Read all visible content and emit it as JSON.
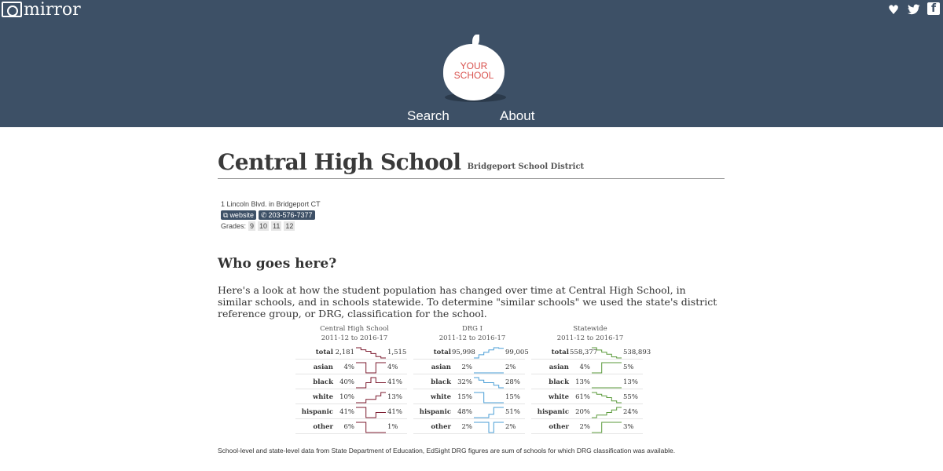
{
  "header": {
    "brand": "mirror",
    "logo_line1": "YOUR",
    "logo_line2": "SCHOOL",
    "nav": [
      "Search",
      "About"
    ],
    "social_icons": [
      "heart-icon",
      "twitter-icon",
      "facebook-icon"
    ]
  },
  "school": {
    "name": "Central High School",
    "district": "Bridgeport School District",
    "address": "1 Lincoln Blvd. in Bridgeport CT",
    "website_label": "website",
    "phone": "203-576-7377",
    "grades_label": "Grades:",
    "grades": [
      "9",
      "10",
      "11",
      "12"
    ]
  },
  "section": {
    "heading": "Who goes here?",
    "paragraph": "Here's a look at how the student population has changed over time at Central High School, in similar schools, and in schools statewide. To determine \"similar schools\" we used the state's district reference group, or DRG, classification for the school."
  },
  "colors": {
    "header_bg": "#3d5066",
    "school": "#7b1a2e",
    "drg": "#4a9ed6",
    "state": "#5a9a3a",
    "logo_text": "#d9534f"
  },
  "chart_data": [
    {
      "type": "line",
      "title": "Central High School",
      "subtitle": "2011-12 to 2016-17",
      "color": "#7b1a2e",
      "rows": [
        {
          "label": "total",
          "start": "2,181",
          "end": "1,515",
          "values": [
            2181,
            2050,
            1950,
            1800,
            1600,
            1515
          ]
        },
        {
          "label": "asian",
          "start": "4%",
          "end": "4%",
          "values": [
            4,
            4,
            1,
            1,
            4,
            4
          ]
        },
        {
          "label": "black",
          "start": "40%",
          "end": "41%",
          "values": [
            40,
            40,
            41,
            42,
            41,
            41
          ]
        },
        {
          "label": "white",
          "start": "10%",
          "end": "13%",
          "values": [
            10,
            10,
            11,
            11,
            12,
            13
          ]
        },
        {
          "label": "hispanic",
          "start": "41%",
          "end": "41%",
          "values": [
            42,
            42,
            40,
            40,
            41,
            41
          ]
        },
        {
          "label": "other",
          "start": "6%",
          "end": "1%",
          "values": [
            6,
            6,
            1,
            1,
            1,
            1
          ]
        }
      ]
    },
    {
      "type": "line",
      "title": "DRG I",
      "subtitle": "2011-12 to 2016-17",
      "color": "#4a9ed6",
      "rows": [
        {
          "label": "total",
          "start": "95,998",
          "end": "99,005",
          "values": [
            95998,
            97000,
            97800,
            98500,
            99200,
            99005
          ]
        },
        {
          "label": "asian",
          "start": "2%",
          "end": "2%",
          "values": [
            2,
            2,
            2,
            2,
            2,
            2
          ]
        },
        {
          "label": "black",
          "start": "32%",
          "end": "28%",
          "values": [
            32,
            31,
            30,
            30,
            29,
            28
          ]
        },
        {
          "label": "white",
          "start": "15%",
          "end": "15%",
          "values": [
            16,
            16,
            15,
            15,
            15,
            15
          ]
        },
        {
          "label": "hispanic",
          "start": "48%",
          "end": "51%",
          "values": [
            48,
            48,
            48,
            49,
            51,
            51
          ]
        },
        {
          "label": "other",
          "start": "2%",
          "end": "2%",
          "values": [
            2,
            2,
            2,
            0,
            2,
            2
          ]
        }
      ]
    },
    {
      "type": "line",
      "title": "Statewide",
      "subtitle": "2011-12 to 2016-17",
      "color": "#5a9a3a",
      "rows": [
        {
          "label": "total",
          "start": "558,377",
          "end": "538,893",
          "values": [
            558377,
            554000,
            550000,
            546000,
            541000,
            538893
          ]
        },
        {
          "label": "asian",
          "start": "4%",
          "end": "5%",
          "values": [
            4,
            4,
            5,
            5,
            5,
            5
          ]
        },
        {
          "label": "black",
          "start": "13%",
          "end": "13%",
          "values": [
            13,
            13,
            13,
            13,
            13,
            13
          ]
        },
        {
          "label": "white",
          "start": "61%",
          "end": "55%",
          "values": [
            61,
            60,
            59,
            58,
            56,
            55
          ]
        },
        {
          "label": "hispanic",
          "start": "20%",
          "end": "24%",
          "values": [
            20,
            21,
            21,
            22,
            23,
            24
          ]
        },
        {
          "label": "other",
          "start": "2%",
          "end": "3%",
          "values": [
            2,
            2,
            3,
            3,
            3,
            3
          ]
        }
      ]
    }
  ],
  "footnote": "School-level and state-level data from State Department of Education, EdSight DRG figures are sum of schools for which DRG classification was available."
}
